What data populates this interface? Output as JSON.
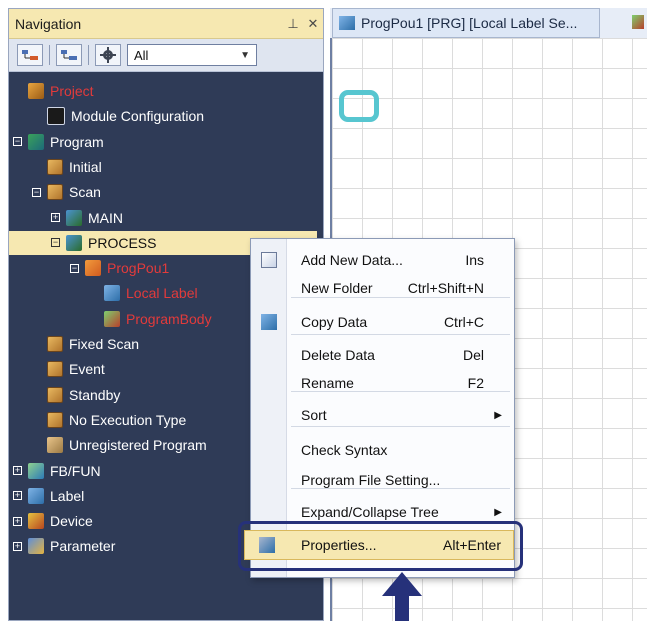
{
  "navigation": {
    "title": "Navigation",
    "pin_glyph": "⊥",
    "close_glyph": "✕",
    "filter_value": "All"
  },
  "tree": [
    {
      "label": "Project",
      "level": 0,
      "icon": "project-icon",
      "expander": "",
      "red": true
    },
    {
      "label": "Module Configuration",
      "level": 1,
      "icon": "module-icon",
      "expander": ""
    },
    {
      "label": "Program",
      "level": 0,
      "icon": "program-icon",
      "expander": "−"
    },
    {
      "label": "Initial",
      "level": 1,
      "icon": "folder-icon",
      "expander": ""
    },
    {
      "label": "Scan",
      "level": 1,
      "icon": "folder-icon",
      "expander": "−"
    },
    {
      "label": "MAIN",
      "level": 2,
      "icon": "program-file-icon",
      "expander": "+"
    },
    {
      "label": "PROCESS",
      "level": 2,
      "icon": "program-file-icon",
      "expander": "−",
      "selected": true
    },
    {
      "label": "ProgPou1",
      "level": 3,
      "icon": "pou-icon",
      "expander": "−",
      "red": true
    },
    {
      "label": "Local Label",
      "level": 4,
      "icon": "label-icon",
      "expander": "",
      "red": true
    },
    {
      "label": "ProgramBody",
      "level": 4,
      "icon": "program-body-icon",
      "expander": "",
      "red": true
    },
    {
      "label": "Fixed Scan",
      "level": 1,
      "icon": "folder-icon",
      "expander": ""
    },
    {
      "label": "Event",
      "level": 1,
      "icon": "folder-icon",
      "expander": ""
    },
    {
      "label": "Standby",
      "level": 1,
      "icon": "folder-icon",
      "expander": ""
    },
    {
      "label": "No Execution Type",
      "level": 1,
      "icon": "folder-icon",
      "expander": ""
    },
    {
      "label": "Unregistered Program",
      "level": 1,
      "icon": "unregistered-icon",
      "expander": ""
    },
    {
      "label": "FB/FUN",
      "level": 0,
      "icon": "fb-fun-icon",
      "expander": "+"
    },
    {
      "label": "Label",
      "level": 0,
      "icon": "label-icon",
      "expander": "+"
    },
    {
      "label": "Device",
      "level": 0,
      "icon": "device-icon",
      "expander": "+"
    },
    {
      "label": "Parameter",
      "level": 0,
      "icon": "parameter-icon",
      "expander": "+"
    }
  ],
  "editor": {
    "tab_title": "ProgPou1 [PRG] [Local Label Se..."
  },
  "context_menu": {
    "items": [
      {
        "label": "Add New Data...",
        "shortcut": "Ins",
        "icon": "add-new-data-icon"
      },
      {
        "label": "New Folder",
        "shortcut": "Ctrl+Shift+N"
      },
      {
        "label": "Copy Data",
        "shortcut": "Ctrl+C",
        "icon": "copy-icon"
      },
      {
        "label": "Delete Data",
        "shortcut": "Del"
      },
      {
        "label": "Rename",
        "shortcut": "F2"
      },
      {
        "label": "Sort",
        "shortcut": "",
        "submenu": true
      },
      {
        "label": "Check Syntax",
        "shortcut": ""
      },
      {
        "label": "Program File Setting...",
        "shortcut": ""
      },
      {
        "label": "Expand/Collapse Tree",
        "shortcut": "",
        "submenu": true
      }
    ],
    "highlighted": {
      "label": "Properties...",
      "shortcut": "Alt+Enter",
      "icon": "properties-icon"
    }
  },
  "colors": {
    "nav_background": "#2f3b57",
    "selection": "#f6e8b1",
    "highlight_frame": "#26317a",
    "cursor_box": "#57c6d0",
    "red_text": "#e23b3b"
  }
}
